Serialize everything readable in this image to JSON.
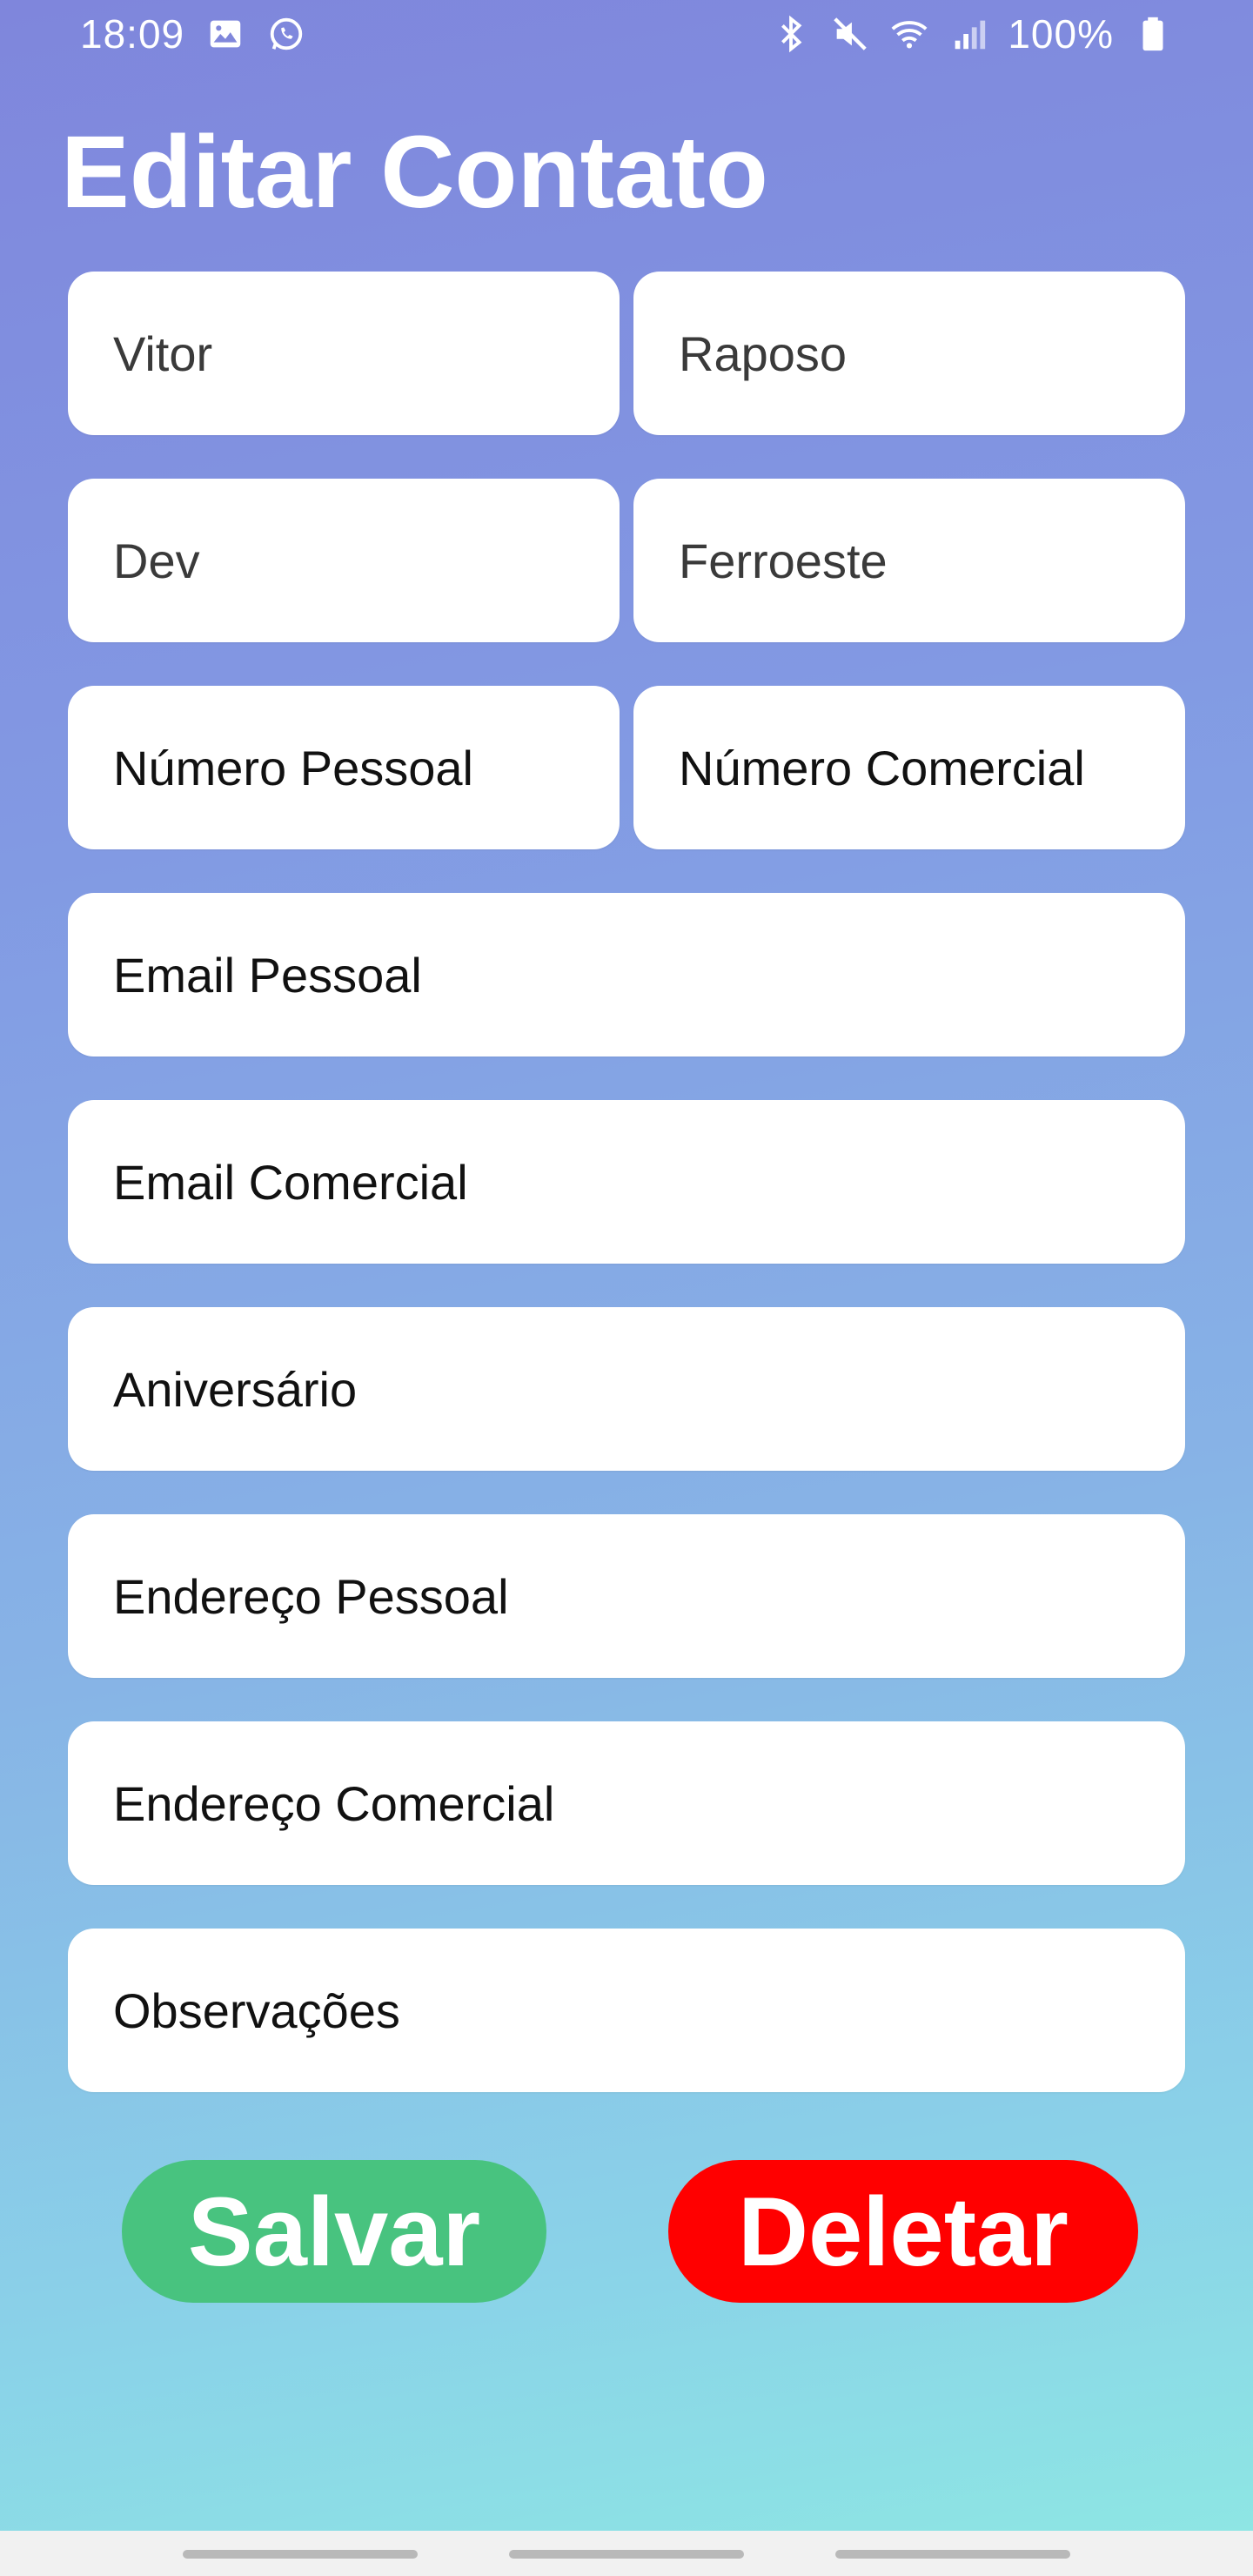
{
  "status_bar": {
    "time": "18:09",
    "battery": "100%",
    "left_icons": [
      "image-icon",
      "whatsapp-icon"
    ],
    "right_icons": [
      "bluetooth-icon",
      "mute-icon",
      "wifi-icon",
      "signal-icon",
      "battery-icon"
    ]
  },
  "page": {
    "title": "Editar Contato"
  },
  "form": {
    "first_name": {
      "value": "Vitor"
    },
    "last_name": {
      "value": "Raposo"
    },
    "job_title": {
      "value": "Dev"
    },
    "company": {
      "value": "Ferroeste"
    },
    "personal_number": {
      "placeholder": "Número Pessoal"
    },
    "business_number": {
      "placeholder": "Número Comercial"
    },
    "personal_email": {
      "placeholder": "Email Pessoal"
    },
    "business_email": {
      "placeholder": "Email Comercial"
    },
    "birthday": {
      "placeholder": "Aniversário"
    },
    "personal_address": {
      "placeholder": "Endereço Pessoal"
    },
    "business_address": {
      "placeholder": "Endereço Comercial"
    },
    "notes": {
      "placeholder": "Observações"
    }
  },
  "actions": {
    "save_label": "Salvar",
    "delete_label": "Deletar",
    "save_color": "#48c37f",
    "delete_color": "#ff0000"
  },
  "navigation_bar": {
    "items": [
      "recent-apps-pill",
      "home-pill",
      "back-pill"
    ]
  }
}
